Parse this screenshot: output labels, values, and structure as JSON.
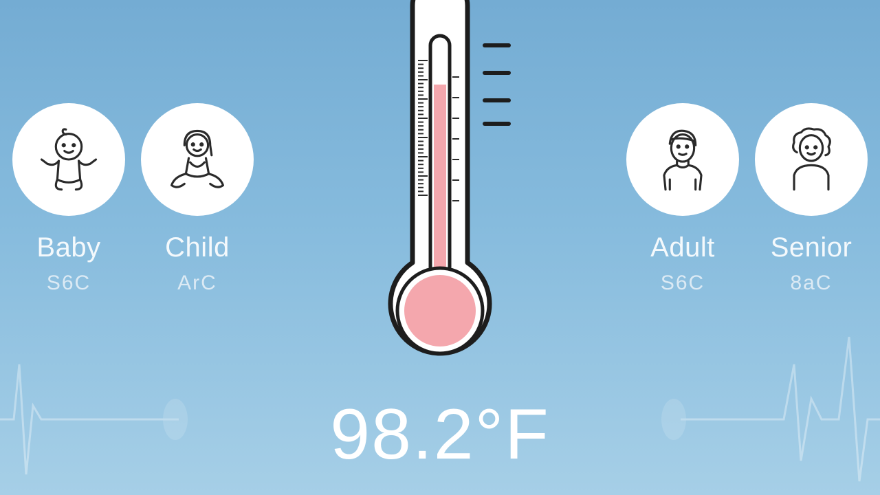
{
  "reading": {
    "value": "98.2°F"
  },
  "groups": [
    {
      "label": "Baby",
      "temp": "S6C",
      "icon": "baby-icon"
    },
    {
      "label": "Child",
      "temp": "ArC",
      "icon": "child-icon"
    },
    {
      "label": "Adult",
      "temp": "S6C",
      "icon": "adult-icon"
    },
    {
      "label": "Senior",
      "temp": "8aC",
      "icon": "senior-icon"
    }
  ],
  "thermometer": {
    "fill_level": 0.82,
    "fill_color": "#f4a7ad",
    "outline_color": "#1d1d1d"
  },
  "colors": {
    "background_top": "#74acd3",
    "background_bottom": "#a6cfe7",
    "text": "#ffffff"
  }
}
